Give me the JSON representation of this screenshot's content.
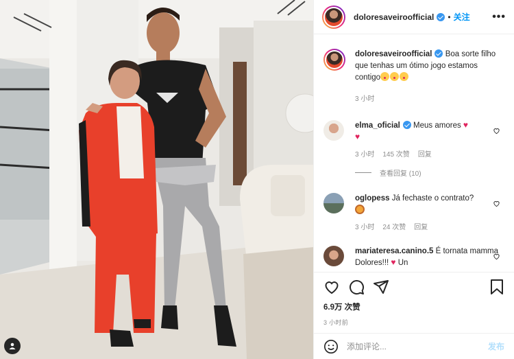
{
  "post": {
    "username": "doloresaveiroofficial",
    "follow_label": "关注",
    "separator": "•",
    "more_label": "•••",
    "caption": "Boa sorte filho que tenhas um ótimo jogo estamos contigo",
    "caption_time": "3 小时"
  },
  "comments": [
    {
      "username": "elma_oficial",
      "text": "Meus amores",
      "time": "3 小时",
      "likes": "145 次赞",
      "reply_label": "回复",
      "view_replies": "查看回复 (10)"
    },
    {
      "username": "oglopess",
      "text": "Já fechaste o contrato?",
      "time": "3 小时",
      "likes": "24 次赞",
      "reply_label": "回复"
    },
    {
      "username": "mariateresa.canino.5",
      "text": "É tornata mamma Dolores!!!",
      "text_tail": "Un"
    }
  ],
  "footer": {
    "likes_count": "6.9万 次赞",
    "time_ago": "3 小时前",
    "comment_placeholder": "添加评论...",
    "post_label": "发布"
  },
  "icons": {
    "verified": "verified-badge-icon",
    "like": "heart-icon",
    "comment": "comment-icon",
    "share": "paper-plane-icon",
    "save": "bookmark-icon",
    "emoji": "smiley-icon",
    "tagged": "user-tag-icon"
  },
  "colors": {
    "accent": "#0095f6",
    "verified": "#3897f0",
    "heart_red": "#e0245e",
    "muted": "#8e8e8e"
  }
}
